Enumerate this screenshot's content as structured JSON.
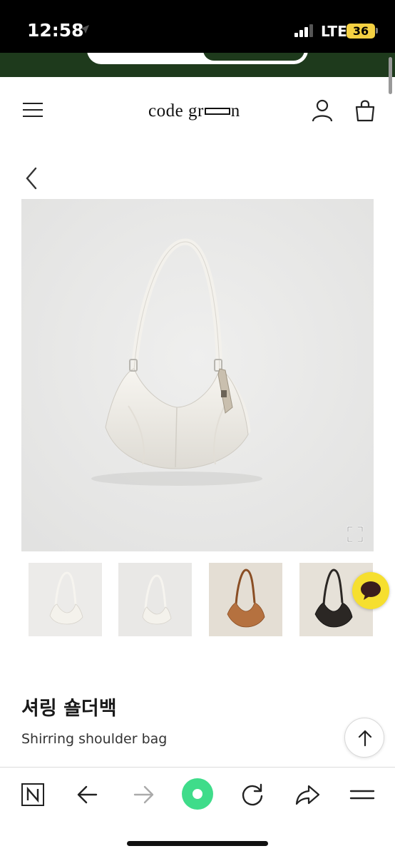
{
  "status_bar": {
    "time": "12:58",
    "network": "LTE",
    "battery": "36"
  },
  "header": {
    "logo_part1": "code gr",
    "logo_part2": "n"
  },
  "product": {
    "title_ko": "셔링 숄더백",
    "title_en": "Shirring shoulder bag"
  },
  "thumbnails": [
    {
      "name": "thumb-ivory-1",
      "color": "#f2f1ee"
    },
    {
      "name": "thumb-ivory-2",
      "color": "#f2f1ee"
    },
    {
      "name": "thumb-brown",
      "color": "#b5713f"
    },
    {
      "name": "thumb-black",
      "color": "#2b2724"
    }
  ],
  "colors": {
    "banner": "#1e3a1c",
    "chat": "#f6df2f",
    "battery": "#f5d142",
    "browser_accent": "#3fdc8a"
  },
  "icons": [
    "menu-icon",
    "user-icon",
    "shopping-bag-icon",
    "back-icon",
    "expand-icon",
    "chat-icon",
    "arrow-up-icon",
    "naver-icon",
    "arrow-left-icon",
    "arrow-right-icon",
    "green-dot-icon",
    "refresh-icon",
    "share-icon",
    "tabs-menu-icon"
  ]
}
